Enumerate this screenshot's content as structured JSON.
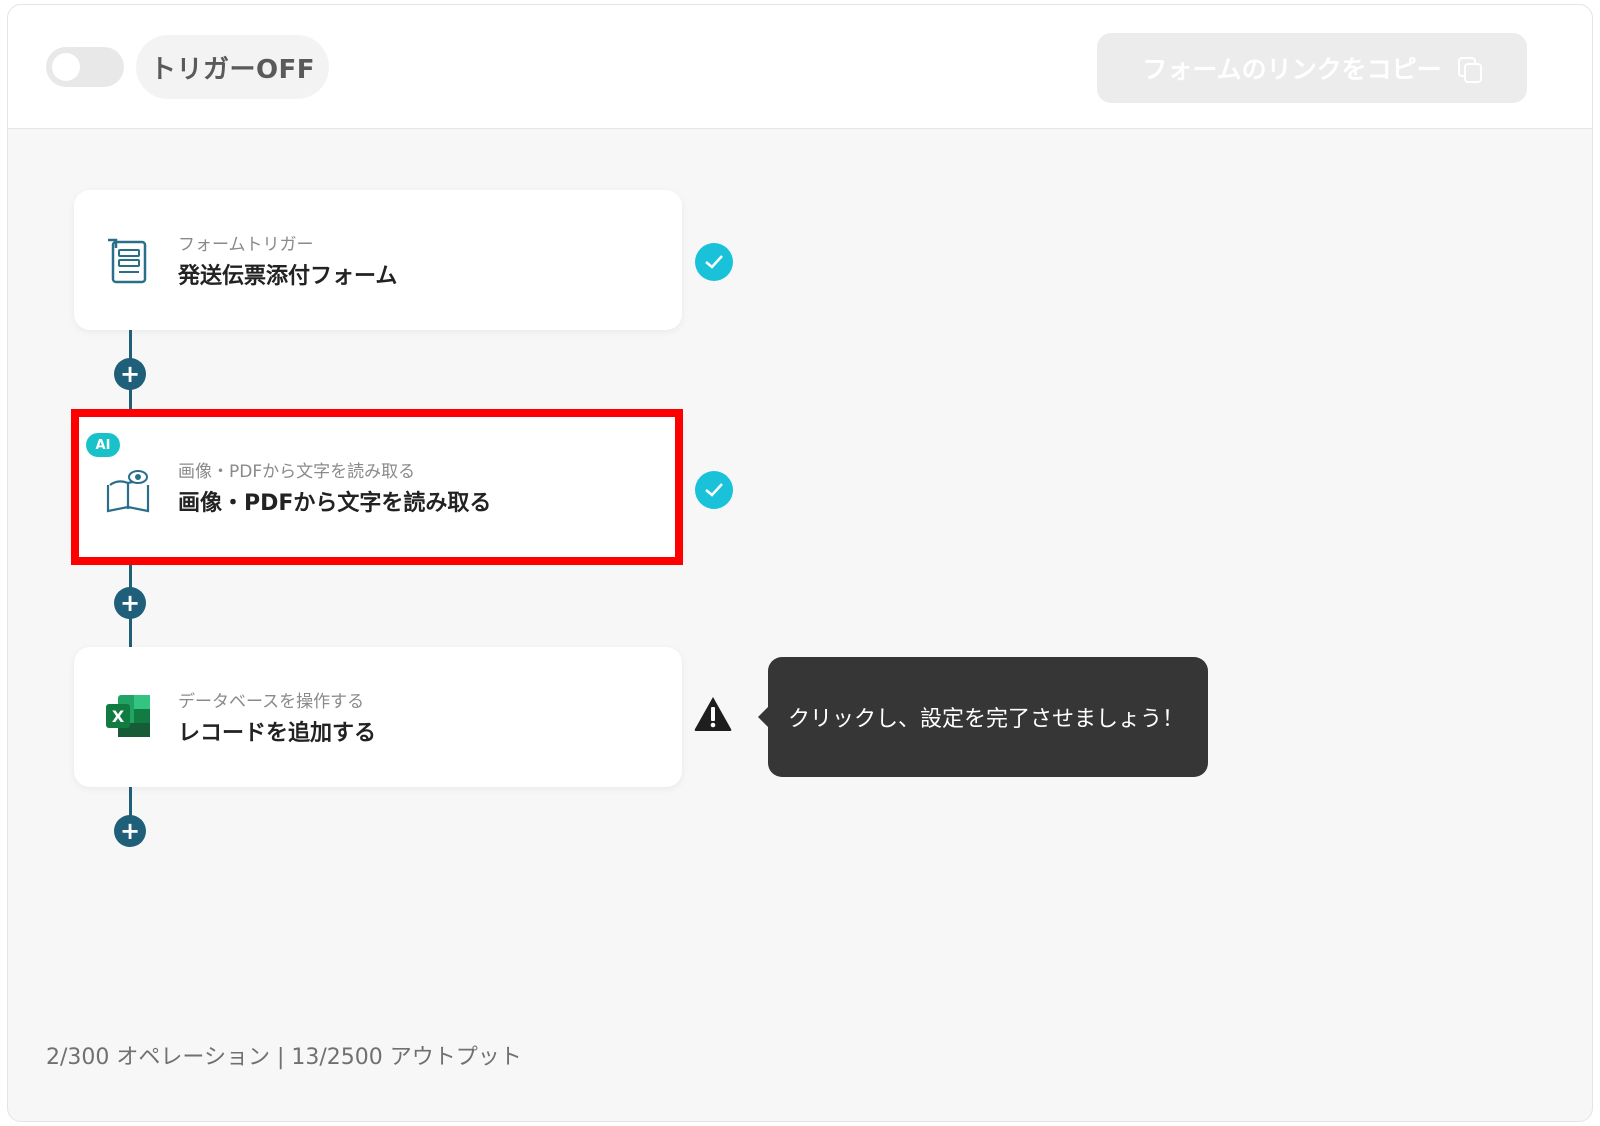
{
  "header": {
    "trigger_toggle_state": "off",
    "trigger_status_label": "トリガーOFF",
    "copy_link_label": "フォームのリンクをコピー"
  },
  "flow": {
    "steps": [
      {
        "category": "フォームトリガー",
        "title": "発送伝票添付フォーム",
        "icon": "form-icon",
        "status": "complete"
      },
      {
        "category": "画像・PDFから文字を読み取る",
        "title": "画像・PDFから文字を読み取る",
        "icon": "book-eye-icon",
        "badge": "AI",
        "status": "complete",
        "highlighted": true
      },
      {
        "category": "データベースを操作する",
        "title": "レコードを追加する",
        "icon": "excel-icon",
        "status": "warning"
      }
    ],
    "tooltip": "クリックし、設定を完了させましょう！"
  },
  "footer": {
    "usage": "2/300 オペレーション | 13/2500 アウトプット"
  },
  "colors": {
    "connector": "#1f5f7a",
    "check": "#19c2d8",
    "highlight": "#ff0000",
    "tooltip_bg": "#363636"
  }
}
